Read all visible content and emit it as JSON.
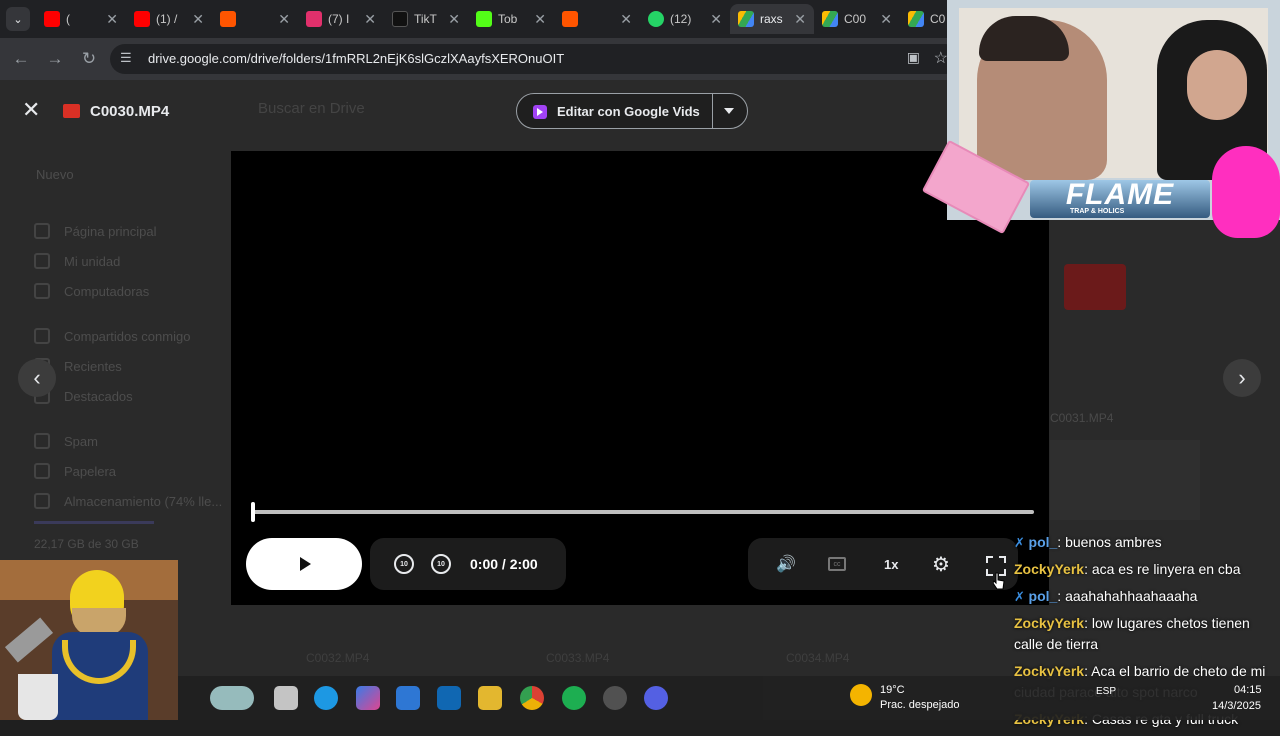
{
  "tabs": [
    {
      "label": "(",
      "favicon_color": "#ff0000",
      "favicon": "youtube-icon"
    },
    {
      "label": "(1) /",
      "favicon_color": "#ff0000",
      "favicon": "youtube-icon"
    },
    {
      "label": "",
      "favicon_color": "#ff5500",
      "favicon": "soundcloud-icon"
    },
    {
      "label": "(7) I",
      "favicon_color": "#e1306c",
      "favicon": "instagram-icon"
    },
    {
      "label": "TikT",
      "favicon_color": "#111111",
      "favicon": "tiktok-icon"
    },
    {
      "label": "Tob",
      "favicon_color": "#53fc18",
      "favicon": "kick-icon"
    },
    {
      "label": "",
      "favicon_color": "#ff5500",
      "favicon": "soundcloud-icon"
    },
    {
      "label": "(12)",
      "favicon_color": "#25d366",
      "favicon": "whatsapp-icon"
    },
    {
      "label": "raxs",
      "favicon_color": "#34a853",
      "favicon": "drive-icon",
      "active": true
    },
    {
      "label": "C00",
      "favicon_color": "#34a853",
      "favicon": "drive-icon"
    },
    {
      "label": "C0",
      "favicon_color": "#34a853",
      "favicon": "drive-icon"
    }
  ],
  "address_bar": {
    "url": "drive.google.com/drive/folders/1fmRRL2nEjK6slGczlXAayfsXEROnuOIT"
  },
  "viewer": {
    "file_name": "C0030.MP4",
    "edit_button": "Editar con Google Vids",
    "time": "0:00 / 2:00",
    "speed": "1x",
    "seek_back": "10",
    "seek_forward": "10",
    "progress": 0
  },
  "drive_background": {
    "search_placeholder": "Buscar en Drive",
    "new_button": "Nuevo",
    "sidebar": [
      "Página principal",
      "Mi unidad",
      "Computadoras",
      "Compartidos conmigo",
      "Recientes",
      "Destacados",
      "Spam",
      "Papelera",
      "Almacenamiento (74% lle..."
    ],
    "storage": "22,17 GB de 30 GB",
    "right_file": "C0031.MP4",
    "bottom_files": [
      "C0032.MP4",
      "C0033.MP4",
      "C0034.MP4"
    ]
  },
  "overlay": {
    "flame_title": "FLAME",
    "flame_subtitle": "TRAP & HOLICS"
  },
  "chat": [
    {
      "user": "pol_",
      "text": ": buenos ambres",
      "badge": true
    },
    {
      "user": "ZockyYerk",
      "text": ": aca es re linyera en cba",
      "badge": false
    },
    {
      "user": "pol_",
      "text": ": aaahahahhaahaaaha",
      "badge": true
    },
    {
      "user": "ZockyYerk",
      "text": ": low lugares chetos tienen calle de tierra",
      "badge": false
    },
    {
      "user": "ZockyYerk",
      "text": ": Aca el barrio de cheto de mi ciudad parace alto spot narco",
      "badge": false
    },
    {
      "user": "ZockyYerk",
      "text": ": Casas re gta y full truck",
      "badge": false
    }
  ],
  "taskbar": {
    "weather_temp": "19°C",
    "weather_desc": "Prac. despejado",
    "lang": "ESP",
    "time": "04:15",
    "date": "14/3/2025"
  }
}
